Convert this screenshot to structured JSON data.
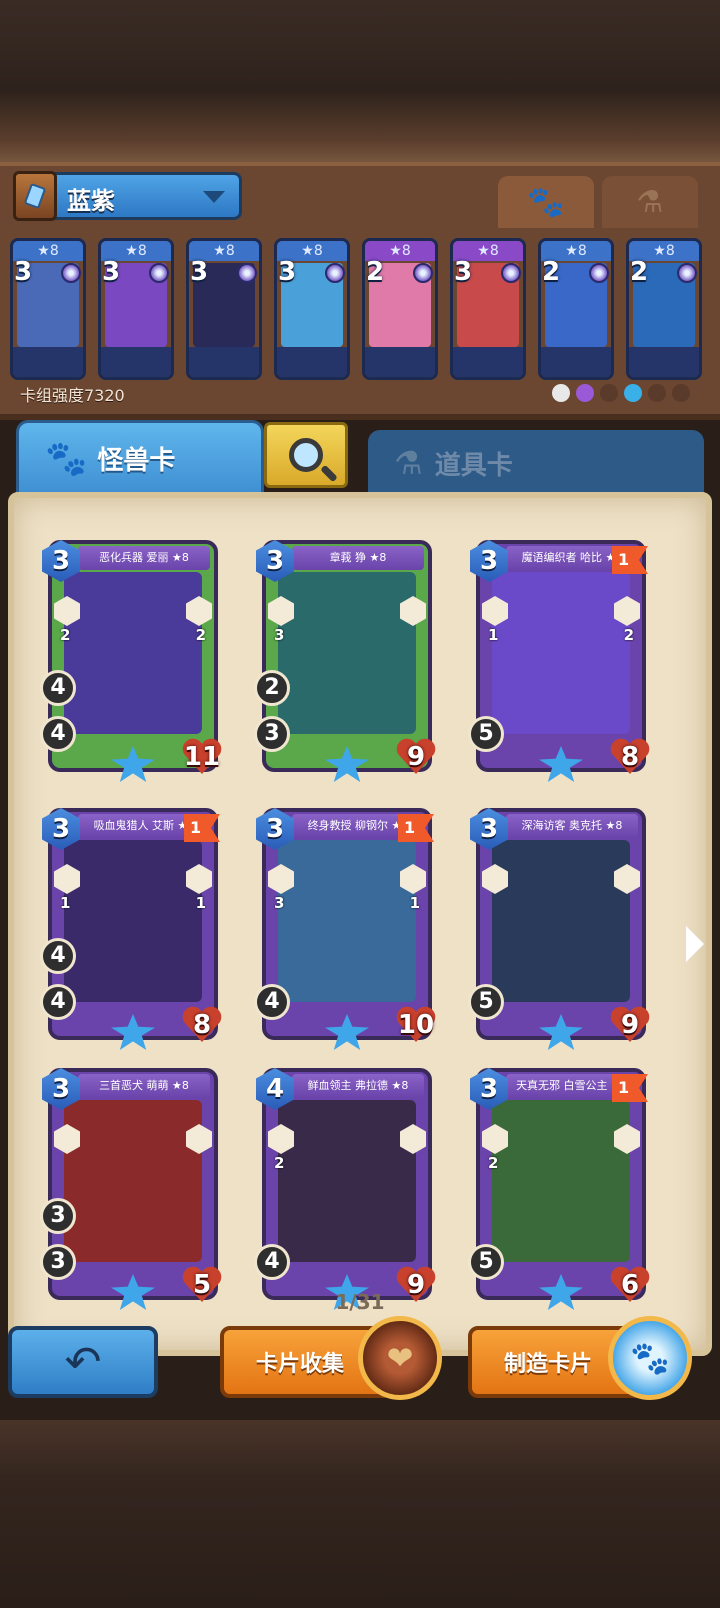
{
  "deck": {
    "name": "蓝紫",
    "power_label": "卡组强度7320",
    "type_tabs": [
      {
        "name": "monster",
        "icon": "paw-icon",
        "active": true
      },
      {
        "name": "item",
        "icon": "potion-icon",
        "active": false
      }
    ],
    "mini_cards": [
      {
        "stars": "★8",
        "cost": "3",
        "color": "#4a6ab8"
      },
      {
        "stars": "★8",
        "cost": "3",
        "color": "#7a48c0"
      },
      {
        "stars": "★8",
        "cost": "3",
        "color": "#2a2a58"
      },
      {
        "stars": "★8",
        "cost": "3",
        "color": "#4aa0d8"
      },
      {
        "stars": "★8",
        "cost": "2",
        "color": "#e07aa8"
      },
      {
        "stars": "★8",
        "cost": "3",
        "color": "#c84a4a"
      },
      {
        "stars": "★8",
        "cost": "2",
        "color": "#3a68c8"
      },
      {
        "stars": "★8",
        "cost": "2",
        "color": "#2a6ab8"
      }
    ]
  },
  "tabs": {
    "monster_label": "怪兽卡",
    "item_label": "道具卡"
  },
  "cards": [
    {
      "title": "恶化兵器 爱丽 ★8",
      "cost": "3",
      "flag": "",
      "left_num": "2",
      "right_num": "2",
      "mid1": "4",
      "mid2": "4",
      "hp": "11",
      "art": "#4a3a9a",
      "frame": "#5aa84a"
    },
    {
      "title": "章莪 狰 ★8",
      "cost": "3",
      "flag": "",
      "left_num": "3",
      "right_num": "",
      "mid1": "2",
      "mid2": "3",
      "hp": "9",
      "art": "#2a6a6a",
      "frame": "#5aa84a"
    },
    {
      "title": "魔语编织者 哈比 ★8",
      "cost": "3",
      "flag": "1",
      "left_num": "1",
      "right_num": "2",
      "mid1": "",
      "mid2": "5",
      "hp": "8",
      "art": "#6a4ac8",
      "frame": "#6a44aa"
    },
    {
      "title": "吸血鬼猎人 艾斯 ★8",
      "cost": "3",
      "flag": "1",
      "left_num": "1",
      "right_num": "1",
      "mid1": "4",
      "mid2": "4",
      "hp": "8",
      "art": "#3a2a6a",
      "frame": "#6a44aa"
    },
    {
      "title": "终身教授 柳钢尔 ★8",
      "cost": "3",
      "flag": "1",
      "left_num": "3",
      "right_num": "1",
      "mid1": "",
      "mid2": "4",
      "hp": "10",
      "art": "#3a6a9a",
      "frame": "#6a44aa"
    },
    {
      "title": "深海访客 奥克托 ★8",
      "cost": "3",
      "flag": "",
      "left_num": "",
      "right_num": "",
      "mid1": "",
      "mid2": "5",
      "hp": "9",
      "art": "#2a3a5a",
      "frame": "#6a44aa"
    },
    {
      "title": "三首恶犬 萌萌 ★8",
      "cost": "3",
      "flag": "",
      "left_num": "",
      "right_num": "",
      "mid1": "3",
      "mid2": "3",
      "hp": "5",
      "art": "#8a2a2a",
      "frame": "#6a44aa"
    },
    {
      "title": "鲜血领主 弗拉德 ★8",
      "cost": "4",
      "flag": "",
      "left_num": "2",
      "right_num": "",
      "mid1": "",
      "mid2": "4",
      "hp": "9",
      "art": "#3a2a4a",
      "frame": "#6a44aa"
    },
    {
      "title": "天真无邪 白雪公主 ★8",
      "cost": "3",
      "flag": "1",
      "left_num": "2",
      "right_num": "",
      "mid1": "",
      "mid2": "5",
      "hp": "6",
      "art": "#3a6a3a",
      "frame": "#6a44aa"
    }
  ],
  "page_indicator": "1/31",
  "buttons": {
    "collect_label": "卡片收集",
    "craft_label": "制造卡片"
  },
  "colors": {
    "blue_accent": "#3f8fd2",
    "orange_accent": "#e37414",
    "parchment": "#eee1c6"
  }
}
